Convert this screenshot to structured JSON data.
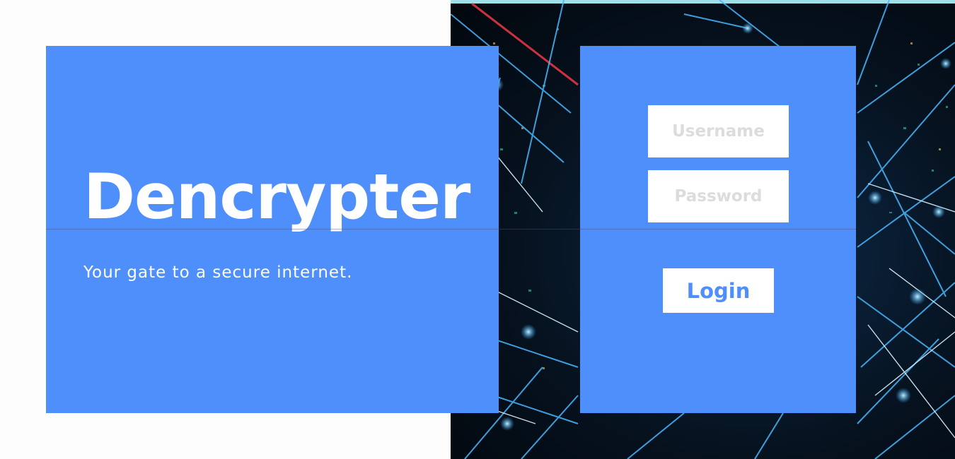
{
  "brand": {
    "title": "Dencrypter",
    "tagline": "Your gate to a secure internet."
  },
  "login": {
    "username_placeholder": "Username",
    "password_placeholder": "Password",
    "login_label": "Login"
  },
  "colors": {
    "panel_blue": "#4f8ffc",
    "field_white": "#ffffff",
    "placeholder_gray": "#dcdcdc",
    "page_background": "#fdfdfd"
  },
  "background_image": {
    "subject": "network-lights-cityscape"
  }
}
